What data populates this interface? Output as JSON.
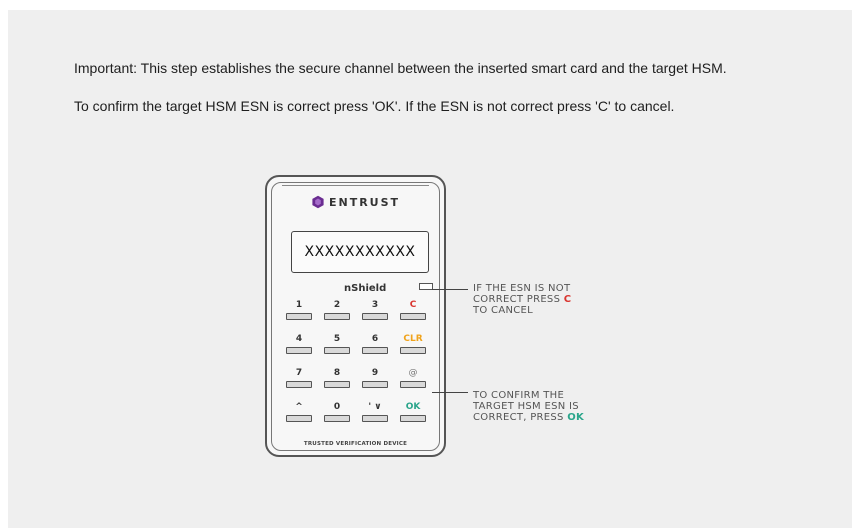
{
  "instructions": {
    "line1": "Important: This step establishes the secure channel between the inserted smart card and the target HSM.",
    "line2": "To confirm the target HSM ESN is correct press 'OK'. If the ESN is not correct press 'C' to cancel."
  },
  "device": {
    "brand": "ENTRUST",
    "display": "XXXXXXXXXXX",
    "model": "nShield",
    "footer": "TRUSTED VERIFICATION DEVICE",
    "keys": {
      "k1": "1",
      "k2": "2",
      "k3": "3",
      "kc": "C",
      "k4": "4",
      "k5": "5",
      "k6": "6",
      "kclr": "CLR",
      "k7": "7",
      "k8": "8",
      "k9": "9",
      "kat": "@",
      "kup": "^",
      "k0": "0",
      "kdot": "' ∨",
      "kok": "OK"
    }
  },
  "callouts": {
    "cancel_line1": "IF THE ESN IS NOT",
    "cancel_line2_prefix": "CORRECT PRESS ",
    "cancel_key": "C",
    "cancel_line3": "TO CANCEL",
    "confirm_line1": "TO CONFIRM THE",
    "confirm_line2": "TARGET HSM ESN IS",
    "confirm_line3_prefix": "CORRECT, PRESS ",
    "confirm_key": "OK"
  },
  "colors": {
    "cancel": "#d9352f",
    "clear": "#f0a31c",
    "ok": "#2aa58b",
    "brand": "#6a2c91"
  }
}
